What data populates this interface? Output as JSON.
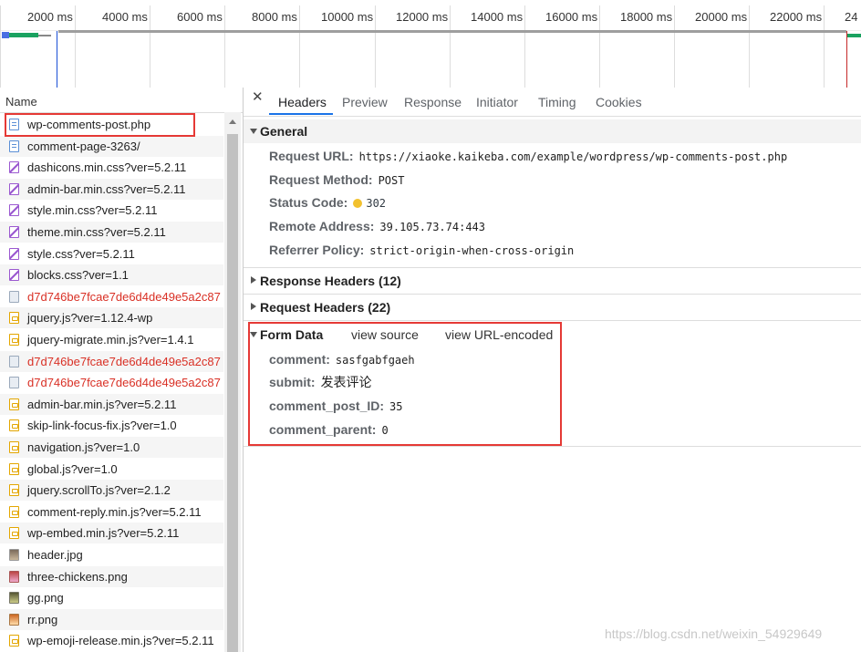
{
  "timeline": {
    "ticks": [
      "2000 ms",
      "4000 ms",
      "6000 ms",
      "8000 ms",
      "10000 ms",
      "12000 ms",
      "14000 ms",
      "16000 ms",
      "18000 ms",
      "20000 ms",
      "22000 ms",
      "24"
    ]
  },
  "name_panel": {
    "header": "Name",
    "requests": [
      {
        "name": "wp-comments-post.php",
        "icon": "document-icon",
        "color": "#222222"
      },
      {
        "name": "comment-page-3263/",
        "icon": "document-icon",
        "color": "#222222"
      },
      {
        "name": "dashicons.min.css?ver=5.2.11",
        "icon": "stylesheet-icon",
        "color": "#222222"
      },
      {
        "name": "admin-bar.min.css?ver=5.2.11",
        "icon": "stylesheet-icon",
        "color": "#222222"
      },
      {
        "name": "style.min.css?ver=5.2.11",
        "icon": "stylesheet-icon",
        "color": "#222222"
      },
      {
        "name": "theme.min.css?ver=5.2.11",
        "icon": "stylesheet-icon",
        "color": "#222222"
      },
      {
        "name": "style.css?ver=5.2.11",
        "icon": "stylesheet-icon",
        "color": "#222222"
      },
      {
        "name": "blocks.css?ver=1.1",
        "icon": "stylesheet-icon",
        "color": "#222222"
      },
      {
        "name": "d7d746be7fcae7de6d4de49e5a2c87",
        "icon": "image-icon",
        "color": "#d93025"
      },
      {
        "name": "jquery.js?ver=1.12.4-wp",
        "icon": "script-icon",
        "color": "#222222"
      },
      {
        "name": "jquery-migrate.min.js?ver=1.4.1",
        "icon": "script-icon",
        "color": "#222222"
      },
      {
        "name": "d7d746be7fcae7de6d4de49e5a2c87",
        "icon": "image-icon",
        "color": "#d93025"
      },
      {
        "name": "d7d746be7fcae7de6d4de49e5a2c87",
        "icon": "image-icon",
        "color": "#d93025"
      },
      {
        "name": "admin-bar.min.js?ver=5.2.11",
        "icon": "script-icon",
        "color": "#222222"
      },
      {
        "name": "skip-link-focus-fix.js?ver=1.0",
        "icon": "script-icon",
        "color": "#222222"
      },
      {
        "name": "navigation.js?ver=1.0",
        "icon": "script-icon",
        "color": "#222222"
      },
      {
        "name": "global.js?ver=1.0",
        "icon": "script-icon",
        "color": "#222222"
      },
      {
        "name": "jquery.scrollTo.js?ver=2.1.2",
        "icon": "script-icon",
        "color": "#222222"
      },
      {
        "name": "comment-reply.min.js?ver=5.2.11",
        "icon": "script-icon",
        "color": "#222222"
      },
      {
        "name": "wp-embed.min.js?ver=5.2.11",
        "icon": "script-icon",
        "color": "#222222"
      },
      {
        "name": "header.jpg",
        "icon": "photo-icon",
        "color": "#222222"
      },
      {
        "name": "three-chickens.png",
        "icon": "photo-icon",
        "color": "#222222"
      },
      {
        "name": "gg.png",
        "icon": "photo-icon",
        "color": "#222222"
      },
      {
        "name": "rr.png",
        "icon": "photo-icon",
        "color": "#222222"
      },
      {
        "name": "wp-emoji-release.min.js?ver=5.2.11",
        "icon": "script-icon",
        "color": "#222222"
      }
    ]
  },
  "tabs": [
    "Headers",
    "Preview",
    "Response",
    "Initiator",
    "Timing",
    "Cookies"
  ],
  "general": {
    "title": "General",
    "request_url_label": "Request URL:",
    "request_url": "https://xiaoke.kaikeba.com/example/wordpress/wp-comments-post.php",
    "request_method_label": "Request Method:",
    "request_method": "POST",
    "status_code_label": "Status Code:",
    "status_code": "302",
    "remote_address_label": "Remote Address:",
    "remote_address": "39.105.73.74:443",
    "referrer_policy_label": "Referrer Policy:",
    "referrer_policy": "strict-origin-when-cross-origin"
  },
  "response_headers": "Response Headers (12)",
  "request_headers": "Request Headers (22)",
  "form_data": {
    "title": "Form Data",
    "view_source": "view source",
    "view_url_encoded": "view URL-encoded",
    "fields": [
      {
        "key": "comment:",
        "value": "sasfgabfgaeh"
      },
      {
        "key": "submit:",
        "value": "发表评论"
      },
      {
        "key": "comment_post_ID:",
        "value": "35"
      },
      {
        "key": "comment_parent:",
        "value": "0"
      }
    ]
  },
  "watermark": "https://blog.csdn.net/weixin_54929649",
  "colors": {
    "highlight": "#e53935",
    "accent": "#1a73e8",
    "error_text": "#d93025"
  }
}
